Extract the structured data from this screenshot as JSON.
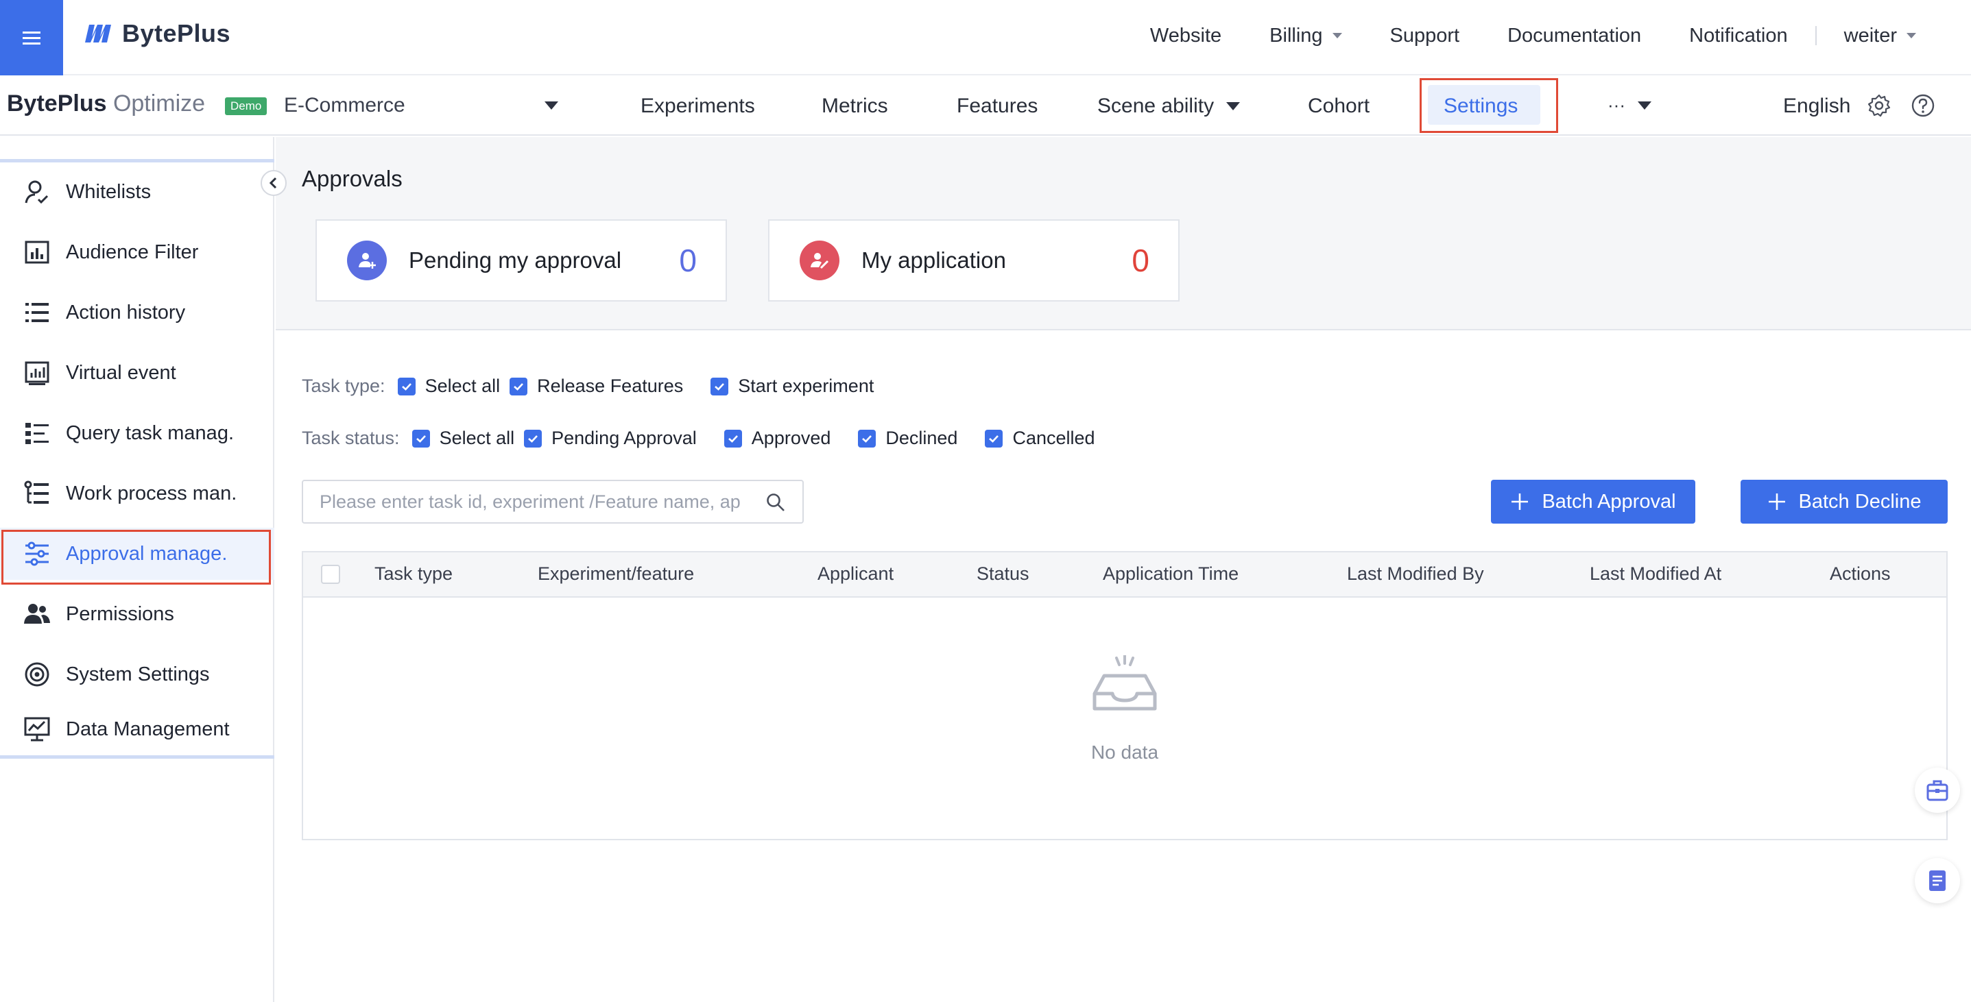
{
  "topbar": {
    "brand": "BytePlus",
    "nav": [
      "Website",
      "Billing",
      "Support",
      "Documentation",
      "Notification"
    ],
    "user": "weiter"
  },
  "subbar": {
    "product_bold": "BytePlus",
    "product_light": "Optimize",
    "badge": "Demo",
    "project": "E-Commerce",
    "tabs": {
      "experiments": "Experiments",
      "metrics": "Metrics",
      "features": "Features",
      "scene": "Scene ability",
      "cohort": "Cohort",
      "settings": "Settings",
      "more": "···"
    },
    "language": "English"
  },
  "sidebar": {
    "items": [
      {
        "label": "Whitelists",
        "icon": "user-check-icon"
      },
      {
        "label": "Audience Filter",
        "icon": "bar-chart-box-icon"
      },
      {
        "label": "Action history",
        "icon": "list-icon"
      },
      {
        "label": "Virtual event",
        "icon": "chart-box-icon"
      },
      {
        "label": "Query task manag.",
        "icon": "task-list-icon"
      },
      {
        "label": "Work process man.",
        "icon": "process-list-icon"
      },
      {
        "label": "Approval manage.",
        "icon": "sliders-icon"
      },
      {
        "label": "Permissions",
        "icon": "users-icon"
      },
      {
        "label": "System Settings",
        "icon": "target-icon"
      },
      {
        "label": "Data Management",
        "icon": "monitor-chart-icon"
      }
    ],
    "active": "Approval manage."
  },
  "main": {
    "title": "Approvals",
    "cards": [
      {
        "label": "Pending my approval",
        "count": "0",
        "color": "#5b6ee1"
      },
      {
        "label": "My application",
        "count": "0",
        "color": "#e05260"
      }
    ],
    "task_type": {
      "label": "Task type:",
      "options": [
        "Select all",
        "Release Features",
        "Start experiment"
      ]
    },
    "task_status": {
      "label": "Task status:",
      "options": [
        "Select all",
        "Pending Approval",
        "Approved",
        "Declined",
        "Cancelled"
      ]
    },
    "search_placeholder": "Please enter task id, experiment /Feature name, ap",
    "buttons": {
      "batch_approval": "Batch Approval",
      "batch_decline": "Batch Decline"
    },
    "table": {
      "columns": [
        "Task type",
        "Experiment/feature",
        "Applicant",
        "Status",
        "Application Time",
        "Last Modified By",
        "Last Modified At",
        "Actions"
      ],
      "empty": "No data"
    }
  },
  "colors": {
    "accent": "#3c6ee8",
    "highlight_border": "#e04a36"
  }
}
